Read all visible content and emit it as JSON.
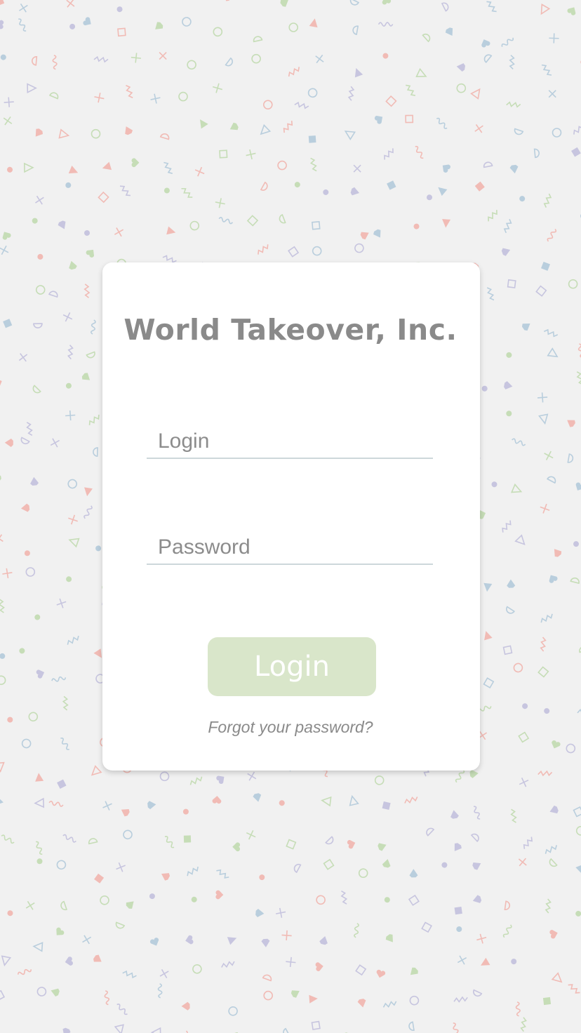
{
  "brand": {
    "title": "World Takeover, Inc."
  },
  "form": {
    "login_placeholder": "Login",
    "password_placeholder": "Password",
    "submit_label": "Login",
    "forgot_link": "Forgot your password?"
  },
  "colors": {
    "background": "#f1f1f1",
    "card": "#ffffff",
    "submit_button": "#d9e6ca",
    "field_underline": "#cdd7da",
    "pattern_pink": "#f0a8a0",
    "pattern_green": "#b7d6a3",
    "pattern_blue": "#a6c1d6",
    "pattern_purple": "#b8b6d8"
  }
}
